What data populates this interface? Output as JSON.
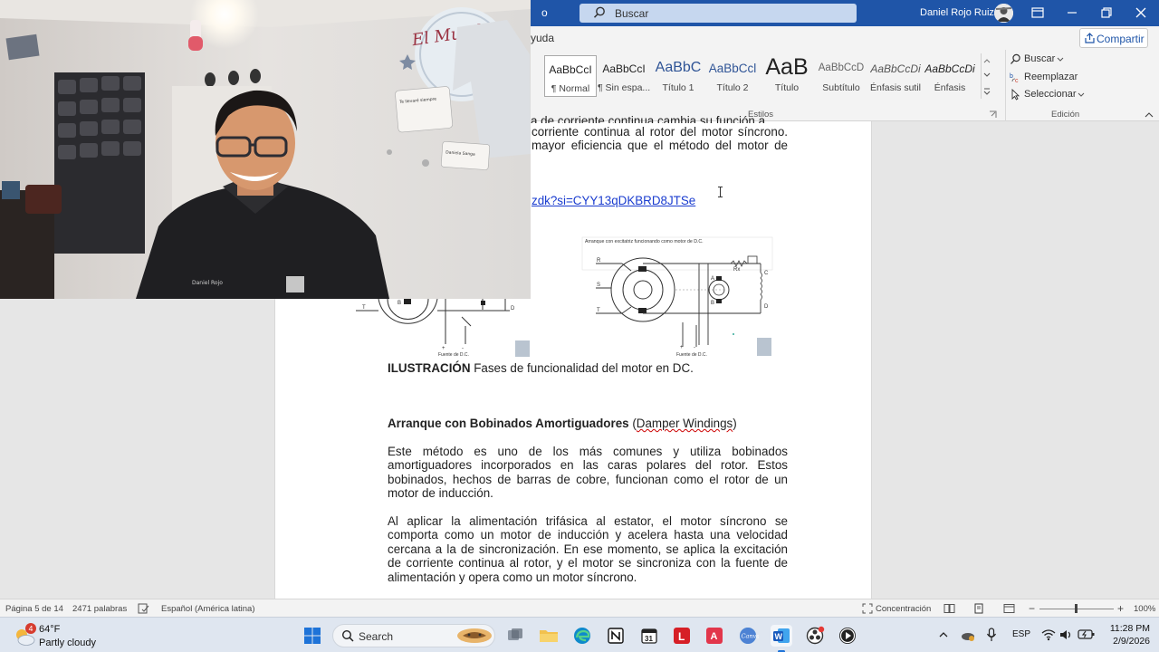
{
  "titlebar": {
    "app_fragment": "o",
    "search_placeholder": "Buscar",
    "user_name": "Daniel Rojo Ruiz"
  },
  "ribbon": {
    "tab_fragment": "yuda",
    "share_label": "Compartir",
    "styles": [
      {
        "sample": "AaBbCcI",
        "name": "¶ Normal"
      },
      {
        "sample": "AaBbCcI",
        "name": "¶ Sin espa..."
      },
      {
        "sample": "AaBbC",
        "name": "Título 1"
      },
      {
        "sample": "AaBbCcl",
        "name": "Título 2"
      },
      {
        "sample": "AaB",
        "name": "Título"
      },
      {
        "sample": "AaBbCcD",
        "name": "Subtítulo"
      },
      {
        "sample": "AaBbCcDi",
        "name": "Énfasis sutil"
      },
      {
        "sample": "AaBbCcDi",
        "name": "Énfasis"
      }
    ],
    "styles_group_label": "Estilos",
    "editing": {
      "find": "Buscar",
      "replace": "Reemplazar",
      "select": "Seleccionar",
      "group_label": "Edición"
    }
  },
  "document": {
    "cut_top_line": "a de corriente continua cambia su función a",
    "para_top": [
      "corriente continua al rotor del motor síncrono.",
      "mayor eficiencia que el método del motor de"
    ],
    "link_fragment": "zdk?si=CYY13qDKBRD8JTSe",
    "figure_right": {
      "title": "Arranque con excitatriz funcionando como motor de D.C.",
      "labels": {
        "r": "R",
        "s": "S",
        "t": "T",
        "a": "A",
        "b": "B",
        "rx": "Rx",
        "c": "C",
        "d": "D",
        "plus": "+",
        "minus": "-",
        "source": "Fuente de D.C."
      }
    },
    "figure_left": {
      "labels": {
        "t": "T",
        "b": "B",
        "d": "D",
        "plus": "+",
        "minus": "-",
        "source": "Fuente de D.C."
      }
    },
    "caption_bold": "ILUSTRACIÓN",
    "caption_text": " Fases de funcionalidad del motor en DC.",
    "heading_bold": "Arranque con Bobinados Amortiguadores",
    "heading_paren_open": " (",
    "heading_paren_text": "Damper Windings",
    "heading_paren_close": ")",
    "para1": [
      "Este método es uno de los más comunes y utiliza bobinados",
      "amortiguadores incorporados en las caras polares del rotor. Estos",
      "bobinados, hechos de barras de cobre, funcionan como el rotor de un",
      "motor de inducción."
    ],
    "para2": [
      "Al aplicar la alimentación trifásica al estator, el motor síncrono se",
      "comporta como un motor de inducción y acelera hasta una velocidad",
      "cercana a la de sincronización. En ese momento, se aplica la excitación",
      "de corriente continua al rotor, y el motor se sincroniza con la fuente de",
      "alimentación y opera como un motor síncrono."
    ]
  },
  "webcam": {
    "wall_sign": "El Mundo D",
    "note_text": "Te llevaré siempre",
    "note2_text": "Daniela Sanga"
  },
  "statusbar": {
    "page": "Página 5 de 14",
    "words": "2471 palabras",
    "language": "Español (América latina)",
    "focus": "Concentración",
    "zoom_minus": "−",
    "zoom_plus": "+",
    "zoom": "100%",
    "zoom_level": 100
  },
  "taskbar": {
    "weather_temp": "64°F",
    "weather_cond": "Partly cloudy",
    "weather_badge": "4",
    "search_label": "Search",
    "language": "ESP",
    "time": "11:28 PM",
    "date": "2/9/2026"
  },
  "colors": {
    "titlebar": "#1f55a8",
    "link": "#1a3ccf",
    "taskbar": "#dfe6f0"
  }
}
